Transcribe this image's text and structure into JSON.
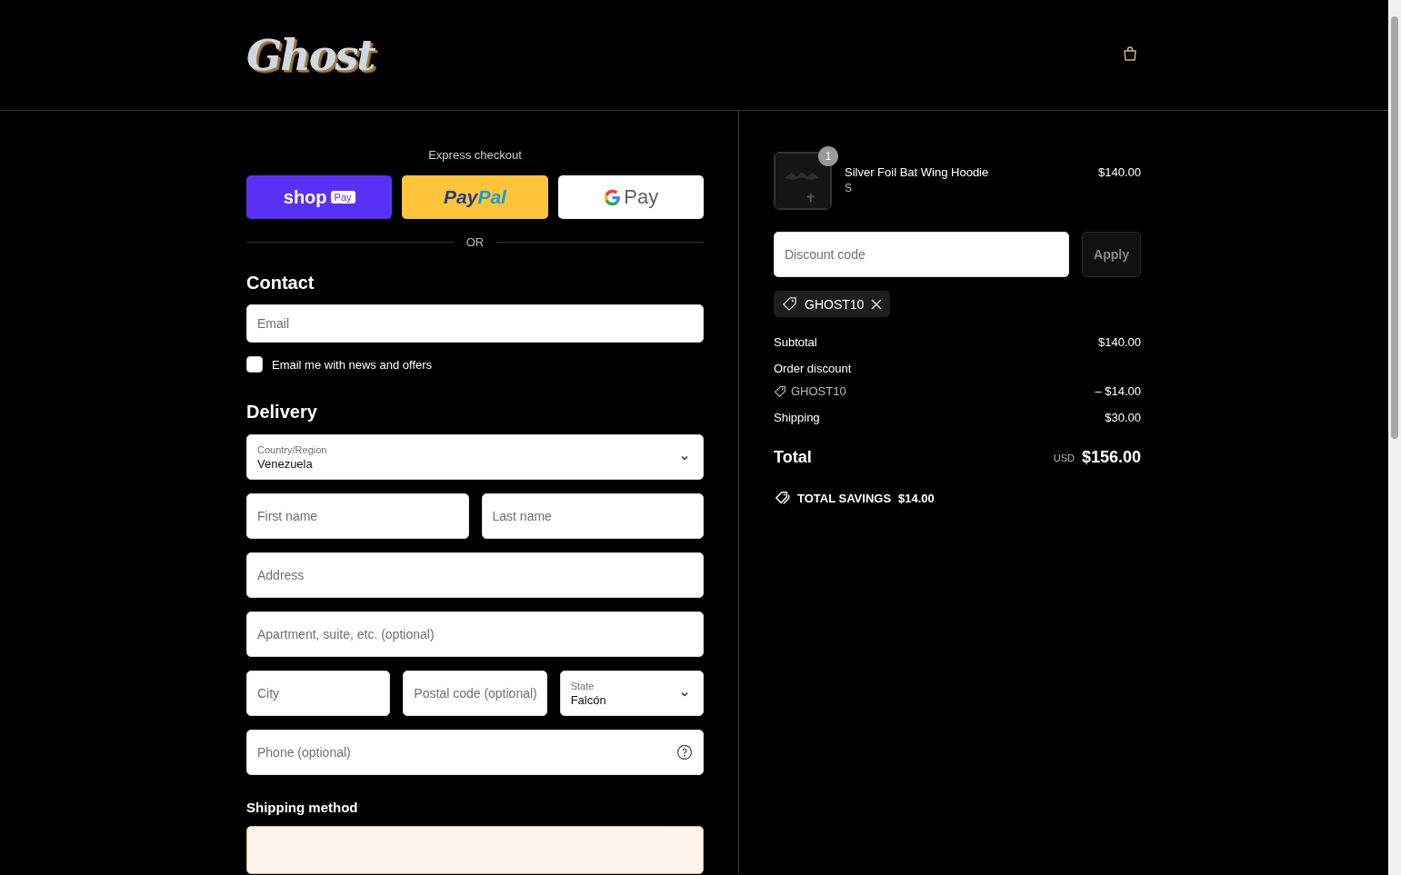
{
  "header": {
    "logo": "Ghost"
  },
  "express": {
    "title": "Express checkout",
    "shop_pay": {
      "label": "shop",
      "badge": "Pay"
    },
    "paypal": {
      "first": "Pay",
      "second": "Pal"
    },
    "gpay": {
      "label": "Pay"
    },
    "divider": "OR"
  },
  "contact": {
    "heading": "Contact",
    "email": {
      "placeholder": "Email"
    },
    "newsletter": {
      "label": "Email me with news and offers",
      "checked": false
    }
  },
  "delivery": {
    "heading": "Delivery",
    "country": {
      "label": "Country/Region",
      "value": "Venezuela"
    },
    "first_name": {
      "placeholder": "First name"
    },
    "last_name": {
      "placeholder": "Last name"
    },
    "address": {
      "placeholder": "Address"
    },
    "apartment": {
      "placeholder": "Apartment, suite, etc. (optional)"
    },
    "city": {
      "placeholder": "City"
    },
    "postal": {
      "placeholder": "Postal code (optional)"
    },
    "state": {
      "label": "State",
      "value": "Falcón"
    },
    "phone": {
      "placeholder": "Phone (optional)"
    }
  },
  "shipping_method": {
    "heading": "Shipping method"
  },
  "order": {
    "item": {
      "name": "Silver Foil Bat Wing Hoodie",
      "variant": "S",
      "price": "$140.00",
      "quantity": "1"
    },
    "discount": {
      "placeholder": "Discount code",
      "button": "Apply",
      "applied": "GHOST10"
    },
    "subtotal": {
      "label": "Subtotal",
      "value": "$140.00"
    },
    "order_discount": {
      "label": "Order discount",
      "code": "GHOST10",
      "value": "– $14.00"
    },
    "shipping": {
      "label": "Shipping",
      "value": "$30.00"
    },
    "total": {
      "label": "Total",
      "currency": "USD",
      "value": "$156.00"
    },
    "savings": {
      "label": "TOTAL SAVINGS",
      "value": "$14.00"
    }
  }
}
